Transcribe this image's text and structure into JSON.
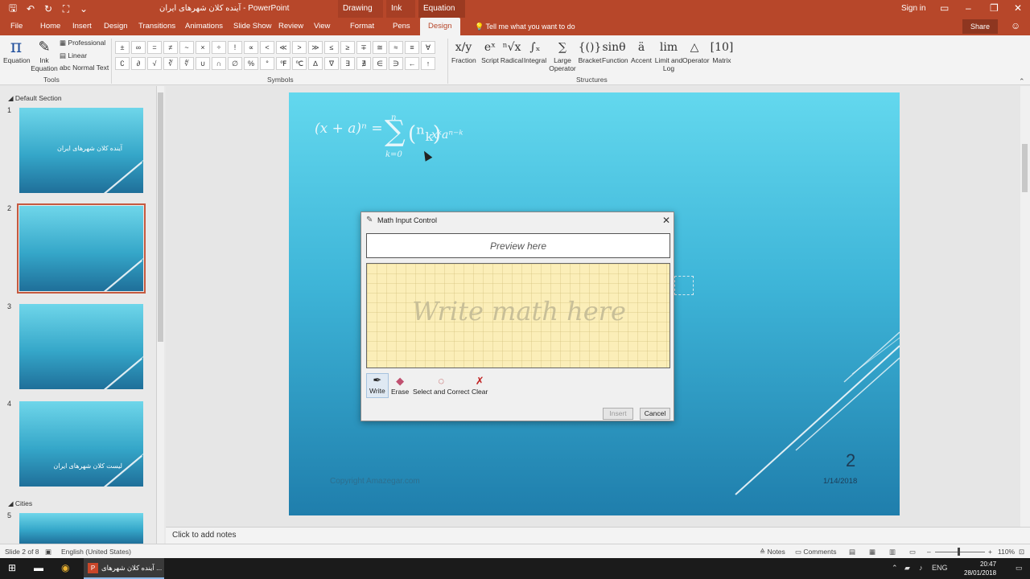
{
  "titlebar": {
    "doc_title": "آینده کلان شهرهای ایران - PowerPoint",
    "ctx_drawing": "Drawing Tools",
    "ctx_ink": "Ink Tools",
    "ctx_equation": "Equation Tools",
    "signin": "Sign in"
  },
  "tabs": {
    "file": "File",
    "home": "Home",
    "insert": "Insert",
    "design": "Design",
    "transitions": "Transitions",
    "animations": "Animations",
    "slideshow": "Slide Show",
    "review": "Review",
    "view": "View",
    "format": "Format",
    "pens": "Pens",
    "eq_design": "Design",
    "tellme": "Tell me what you want to do",
    "share": "Share"
  },
  "ribbon": {
    "equation": "Equation",
    "ink_equation_1": "Ink",
    "ink_equation_2": "Equation",
    "professional": "Professional",
    "linear": "Linear",
    "normal_text": "abc Normal Text",
    "group_tools": "Tools",
    "group_symbols": "Symbols",
    "group_structures": "Structures",
    "symbols_row1": [
      "±",
      "∞",
      "=",
      "≠",
      "~",
      "×",
      "÷",
      "!",
      "∝",
      "<",
      "≪",
      ">",
      "≫",
      "≤",
      "≥",
      "∓",
      "≅",
      "≈",
      "≡",
      "∀"
    ],
    "symbols_row2": [
      "∁",
      "∂",
      "√",
      "∛",
      "∜",
      "∪",
      "∩",
      "∅",
      "%",
      "°",
      "℉",
      "℃",
      "∆",
      "∇",
      "∃",
      "∄",
      "∈",
      "∋",
      "←",
      "↑"
    ],
    "structures": [
      {
        "icon": "x/y",
        "label": "Fraction"
      },
      {
        "icon": "eˣ",
        "label": "Script"
      },
      {
        "icon": "ⁿ√x",
        "label": "Radical"
      },
      {
        "icon": "∫ₓ",
        "label": "Integral"
      },
      {
        "icon": "∑",
        "label": "Large",
        "label2": "Operator"
      },
      {
        "icon": "{()}",
        "label": "Bracket"
      },
      {
        "icon": "sinθ",
        "label": "Function"
      },
      {
        "icon": "ä",
        "label": "Accent"
      },
      {
        "icon": "lim",
        "label": "Limit and",
        "label2": "Log"
      },
      {
        "icon": "△",
        "label": "Operator"
      },
      {
        "icon": "[10]",
        "label": "Matrix"
      }
    ]
  },
  "leftpane": {
    "default_section": "Default Section",
    "cities_section": "Cities",
    "slides": [
      {
        "num": "1",
        "title": "آینده کلان شهرهای ایران"
      },
      {
        "num": "2",
        "title": ""
      },
      {
        "num": "3",
        "title": ""
      },
      {
        "num": "4",
        "title": "لیست کلان شهرهای ایران"
      },
      {
        "num": "5",
        "title": ""
      }
    ]
  },
  "slide": {
    "formula_left": "(x + a)ⁿ =",
    "sigma": "∑",
    "sigma_top": "n",
    "sigma_bottom": "k=0",
    "binom": "(ⁿₖ)",
    "formula_right": "xᵏaⁿ⁻ᵏ",
    "number": "2",
    "date": "1/14/2018",
    "copyright": "Copyright Amazegar.com"
  },
  "dialog": {
    "title": "Math Input Control",
    "preview": "Preview here",
    "write_here": "Write math here",
    "tool_write": "Write",
    "tool_erase": "Erase",
    "tool_select": "Select and Correct",
    "tool_clear": "Clear",
    "insert": "Insert",
    "cancel": "Cancel"
  },
  "notes": {
    "placeholder": "Click to add notes"
  },
  "status": {
    "slide": "Slide 2 of 8",
    "language": "English (United States)",
    "notes": "Notes",
    "comments": "Comments",
    "zoom": "110%"
  },
  "taskbar": {
    "app": "آینده کلان شهرهای ...",
    "lang": "ENG",
    "time": "20:47",
    "date": "28/01/2018"
  },
  "colors": {
    "accent": "#b7472a",
    "slide_top": "#63d8ee",
    "slide_bottom": "#1f7eac"
  }
}
